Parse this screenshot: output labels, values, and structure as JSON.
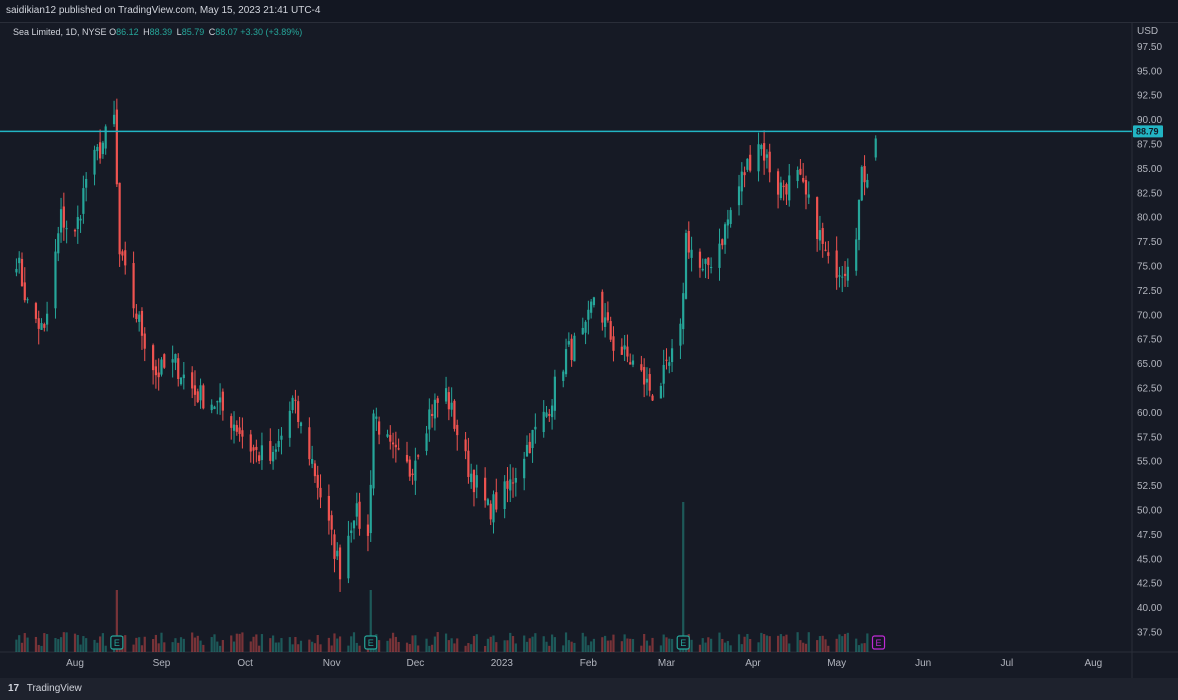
{
  "header": {
    "published": "saidikian12 published on TradingView.com, May 15, 2023 21:41 UTC-4"
  },
  "legend": {
    "symbol": "Sea Limited, 1D, NYSE",
    "o_label": "O",
    "o_value": "86.12",
    "h_label": "H",
    "h_value": "88.39",
    "l_label": "L",
    "l_value": "85.79",
    "c_label": "C",
    "c_value": "88.07 +3.30 (+3.89%)"
  },
  "footer": {
    "brand": "TradingView"
  },
  "colors": {
    "up": "#26a69a",
    "down": "#ef5350",
    "line": "#22b5c4",
    "earnings": "#26a69a",
    "earnings_next": "#c02bd6"
  },
  "chart_data": {
    "type": "candlestick",
    "currency": "USD",
    "yticks": [
      37.5,
      40.0,
      42.5,
      45.0,
      47.5,
      50.0,
      52.5,
      55.0,
      57.5,
      60.0,
      62.5,
      65.0,
      67.5,
      70.0,
      72.5,
      75.0,
      77.5,
      80.0,
      82.5,
      85.0,
      87.5,
      90.0,
      92.5,
      95.0,
      97.5
    ],
    "ytick_labels": [
      "37.50",
      "40.00",
      "42.50",
      "45.00",
      "47.50",
      "50.00",
      "52.50",
      "55.00",
      "57.50",
      "60.00",
      "62.50",
      "65.00",
      "67.50",
      "70.00",
      "72.50",
      "75.00",
      "77.50",
      "80.00",
      "82.50",
      "85.00",
      "87.50",
      "90.00",
      "92.50",
      "95.00",
      "97.50"
    ],
    "ylim": [
      35.0,
      100.0
    ],
    "xaxis_labels": [
      "Aug",
      "Sep",
      "Oct",
      "Nov",
      "Dec",
      "2023",
      "Feb",
      "Mar",
      "Apr",
      "May",
      "Jun",
      "Jul",
      "Aug"
    ],
    "horizontal_line": {
      "value": 88.79,
      "label": "88.79"
    },
    "earnings_markers": [
      {
        "date": "2022-08-16",
        "label": "E"
      },
      {
        "date": "2022-11-15",
        "label": "E"
      },
      {
        "date": "2023-03-07",
        "label": "E"
      },
      {
        "date": "2023-05-16",
        "label": "E",
        "upcoming": true
      }
    ],
    "volume_spikes": [
      {
        "date": "2022-08-16",
        "note": "high"
      },
      {
        "date": "2022-11-15",
        "note": "high"
      },
      {
        "date": "2023-03-07",
        "note": "highest"
      }
    ],
    "price_path": [
      {
        "date": "2022-07-11",
        "close": 76
      },
      {
        "date": "2022-07-15",
        "close": 71
      },
      {
        "date": "2022-07-21",
        "close": 68
      },
      {
        "date": "2022-07-27",
        "close": 80
      },
      {
        "date": "2022-08-01",
        "close": 78
      },
      {
        "date": "2022-08-05",
        "close": 84
      },
      {
        "date": "2022-08-10",
        "close": 87
      },
      {
        "date": "2022-08-15",
        "close": 90
      },
      {
        "date": "2022-08-17",
        "close": 76
      },
      {
        "date": "2022-08-23",
        "close": 70
      },
      {
        "date": "2022-08-30",
        "close": 64
      },
      {
        "date": "2022-09-06",
        "close": 65
      },
      {
        "date": "2022-09-13",
        "close": 62
      },
      {
        "date": "2022-09-20",
        "close": 61
      },
      {
        "date": "2022-09-27",
        "close": 59
      },
      {
        "date": "2022-10-04",
        "close": 56
      },
      {
        "date": "2022-10-11",
        "close": 55
      },
      {
        "date": "2022-10-18",
        "close": 61
      },
      {
        "date": "2022-10-25",
        "close": 55
      },
      {
        "date": "2022-11-01",
        "close": 47
      },
      {
        "date": "2022-11-04",
        "close": 44
      },
      {
        "date": "2022-11-09",
        "close": 50
      },
      {
        "date": "2022-11-14",
        "close": 47
      },
      {
        "date": "2022-11-16",
        "close": 60
      },
      {
        "date": "2022-11-22",
        "close": 56
      },
      {
        "date": "2022-11-29",
        "close": 54
      },
      {
        "date": "2022-12-06",
        "close": 60
      },
      {
        "date": "2022-12-12",
        "close": 62
      },
      {
        "date": "2022-12-19",
        "close": 55
      },
      {
        "date": "2022-12-27",
        "close": 50
      },
      {
        "date": "2023-01-03",
        "close": 52
      },
      {
        "date": "2023-01-09",
        "close": 56
      },
      {
        "date": "2023-01-17",
        "close": 60
      },
      {
        "date": "2023-01-24",
        "close": 66
      },
      {
        "date": "2023-01-31",
        "close": 68
      },
      {
        "date": "2023-02-03",
        "close": 72
      },
      {
        "date": "2023-02-10",
        "close": 67
      },
      {
        "date": "2023-02-17",
        "close": 65
      },
      {
        "date": "2023-02-24",
        "close": 62
      },
      {
        "date": "2023-03-01",
        "close": 64
      },
      {
        "date": "2023-03-06",
        "close": 68
      },
      {
        "date": "2023-03-08",
        "close": 78
      },
      {
        "date": "2023-03-14",
        "close": 74
      },
      {
        "date": "2023-03-21",
        "close": 78
      },
      {
        "date": "2023-03-28",
        "close": 84
      },
      {
        "date": "2023-04-03",
        "close": 88
      },
      {
        "date": "2023-04-10",
        "close": 83
      },
      {
        "date": "2023-04-17",
        "close": 84
      },
      {
        "date": "2023-04-24",
        "close": 79
      },
      {
        "date": "2023-04-28",
        "close": 75
      },
      {
        "date": "2023-05-04",
        "close": 75
      },
      {
        "date": "2023-05-08",
        "close": 79
      },
      {
        "date": "2023-05-10",
        "close": 84
      },
      {
        "date": "2023-05-12",
        "close": 84.77
      },
      {
        "date": "2023-05-15",
        "open": 86.12,
        "high": 88.39,
        "low": 85.79,
        "close": 88.07
      }
    ]
  }
}
